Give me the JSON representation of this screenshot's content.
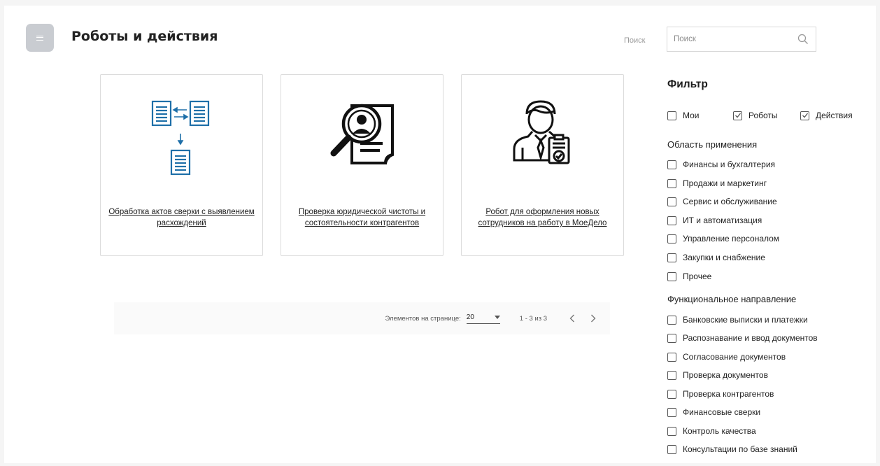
{
  "header": {
    "title": "Роботы и действия",
    "search_label": "Поиск",
    "search_placeholder": "Поиск",
    "search_value": ""
  },
  "cards": [
    {
      "title": "Обработка актов сверки с выявлением расхождений",
      "icon": "documents-compare-icon",
      "accent": "#1e6fa8"
    },
    {
      "title": "Проверка юридической чистоты и состоятельности контрагентов",
      "icon": "magnifier-profile-icon",
      "accent": "#111111"
    },
    {
      "title": "Робот для оформления новых сотрудников на работу в МоеДело",
      "icon": "employee-checklist-icon",
      "accent": "#111111"
    }
  ],
  "pagination": {
    "per_page_label": "Элементов на странице:",
    "per_page_value": "20",
    "range": "1 - 3 из 3"
  },
  "filter": {
    "title": "Фильтр",
    "types": [
      {
        "label": "Мои",
        "checked": false
      },
      {
        "label": "Роботы",
        "checked": true
      },
      {
        "label": "Действия",
        "checked": true
      }
    ],
    "area_title": "Область применения",
    "areas": [
      {
        "label": "Финансы и бухгалтерия",
        "checked": false
      },
      {
        "label": "Продажи и маркетинг",
        "checked": false
      },
      {
        "label": "Сервис и обслуживание",
        "checked": false
      },
      {
        "label": "ИТ и автоматизация",
        "checked": false
      },
      {
        "label": "Управление персоналом",
        "checked": false
      },
      {
        "label": "Закупки и снабжение",
        "checked": false
      },
      {
        "label": "Прочее",
        "checked": false
      }
    ],
    "function_title": "Функциональное направление",
    "functions": [
      {
        "label": "Банковские выписки и платежки",
        "checked": false
      },
      {
        "label": "Распознавание и ввод документов",
        "checked": false
      },
      {
        "label": "Согласование документов",
        "checked": false
      },
      {
        "label": "Проверка документов",
        "checked": false
      },
      {
        "label": "Проверка контрагентов",
        "checked": false
      },
      {
        "label": "Финансовые сверки",
        "checked": false
      },
      {
        "label": "Контроль качества",
        "checked": false
      },
      {
        "label": "Консультации по базе знаний",
        "checked": false
      }
    ]
  }
}
